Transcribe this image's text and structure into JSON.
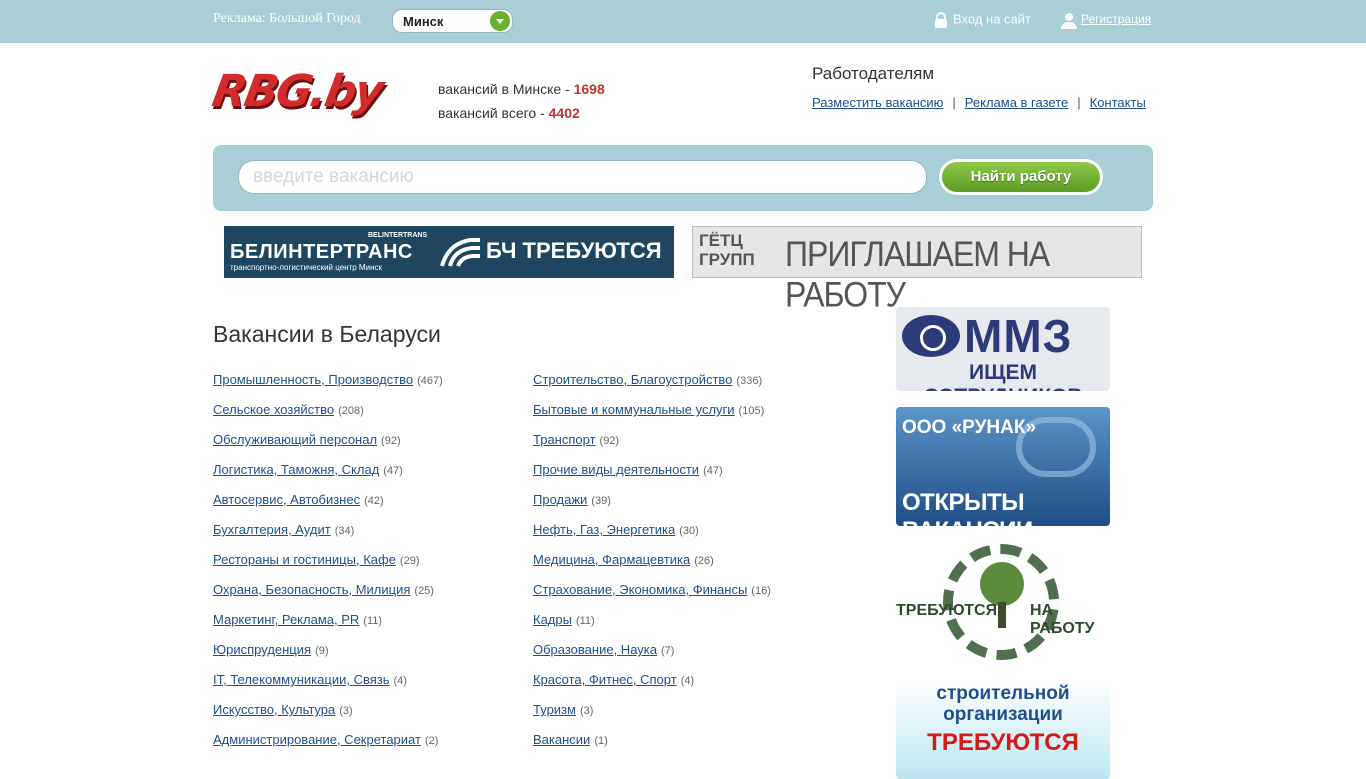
{
  "topbar": {
    "ad_label": "Реклама: Большой Город",
    "city": "Минск",
    "login": "Вход на сайт",
    "register": "Регистрация"
  },
  "logo": {
    "text": "RBG.by"
  },
  "stats": {
    "minsk_label": "вакансий в Минске - ",
    "minsk_count": "1698",
    "total_label": "вакансий всего - ",
    "total_count": "4402"
  },
  "employers": {
    "title": "Работодателям",
    "links": [
      "Разместить вакансию",
      "Реклама в газете",
      "Контакты"
    ],
    "separator": "|"
  },
  "search": {
    "placeholder": "введите вакансию",
    "button": "Найти работу"
  },
  "banners": {
    "belintertrans": {
      "main": "БЕЛИНТЕРТРАНС",
      "small": "BELINTERTRANS",
      "sub": "транспортно-логистический центр Минск",
      "right": "БЧ ТРЕБУЮТСЯ"
    },
    "getz": {
      "left_line1": "ГЁТЦ",
      "left_line2": "ГРУПП",
      "right": "ПРИГЛАШАЕМ НА РАБОТУ"
    }
  },
  "main": {
    "title": "Вакансии в Беларуси",
    "col1": [
      {
        "label": "Промышленность, Производство",
        "count": "(467)"
      },
      {
        "label": "Сельское хозяйство",
        "count": "(208)"
      },
      {
        "label": "Обслуживающий персонал",
        "count": "(92)"
      },
      {
        "label": "Логистика, Таможня, Склад",
        "count": "(47)"
      },
      {
        "label": "Автосервис, Автобизнес",
        "count": "(42)"
      },
      {
        "label": "Бухгалтерия, Аудит",
        "count": "(34)"
      },
      {
        "label": "Рестораны и гостиницы, Кафе",
        "count": "(29)"
      },
      {
        "label": "Охрана, Безопасность, Милиция",
        "count": "(25)"
      },
      {
        "label": "Маркетинг, Реклама, PR",
        "count": "(11)"
      },
      {
        "label": "Юриспруденция",
        "count": "(9)"
      },
      {
        "label": "IT, Телекоммуникации, Связь",
        "count": "(4)"
      },
      {
        "label": "Искусство, Культура",
        "count": "(3)"
      },
      {
        "label": "Администрирование, Секретариат",
        "count": "(2)"
      }
    ],
    "col2": [
      {
        "label": "Строительство, Благоустройство",
        "count": "(336)"
      },
      {
        "label": "Бытовые и коммунальные услуги",
        "count": "(105)"
      },
      {
        "label": "Транспорт",
        "count": "(92)"
      },
      {
        "label": "Прочие виды деятельности",
        "count": "(47)"
      },
      {
        "label": "Продажи",
        "count": "(39)"
      },
      {
        "label": "Нефть, Газ, Энергетика",
        "count": "(30)"
      },
      {
        "label": "Медицина, Фармацевтика",
        "count": "(26)"
      },
      {
        "label": "Страхование, Экономика, Финансы",
        "count": "(16)"
      },
      {
        "label": "Кадры",
        "count": "(11)"
      },
      {
        "label": "Образование, Наука",
        "count": "(7)"
      },
      {
        "label": "Красота, Фитнес, Спорт",
        "count": "(4)"
      },
      {
        "label": "Туризм",
        "count": "(3)"
      },
      {
        "label": "Вакансии",
        "count": "(1)"
      }
    ]
  },
  "side_ads": {
    "mmz": {
      "big": "ММЗ",
      "small": "ИЩЕМ СОТРУДНИКОВ"
    },
    "runak": {
      "t1": "ООО «РУНАК»",
      "t2": "ОТКРЫТЫ ВАКАНСИИ"
    },
    "lesxoz": {
      "left": "ТРЕБУЮТСЯ",
      "right": "НА РАБОТУ"
    },
    "stroy": {
      "t1": "строительной организации",
      "t2": "ТРЕБУЮТСЯ"
    }
  },
  "colors": {
    "topbar": "#a8ced6",
    "link": "#1f4f8a",
    "count_red": "#c8322a",
    "button_green": "#6aae31"
  }
}
